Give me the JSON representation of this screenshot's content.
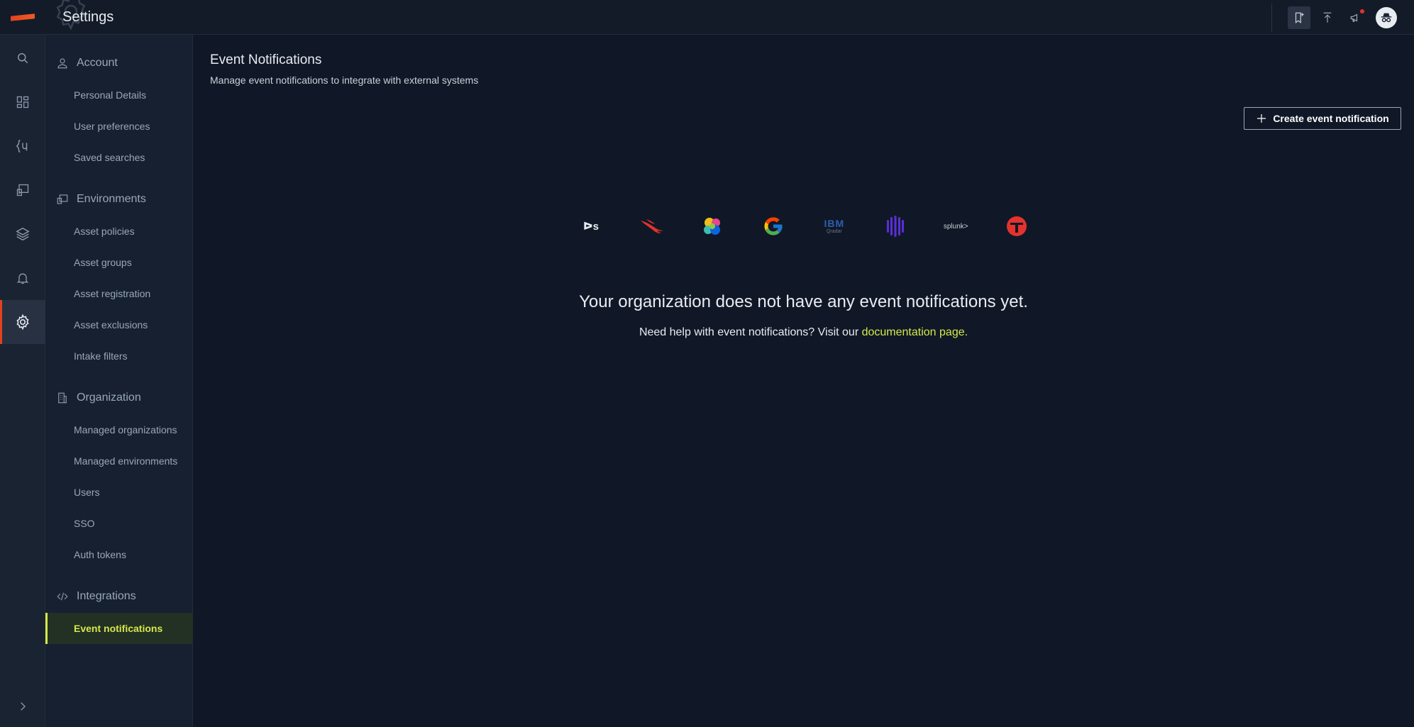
{
  "app": {
    "title": "Settings"
  },
  "colors": {
    "accent": "#e3421f",
    "highlight": "#d4e84a",
    "background": "#101827"
  },
  "topbar": {
    "icons": [
      "bookmark-icon",
      "upload-icon",
      "megaphone-icon",
      "incognito-avatar-icon"
    ]
  },
  "rail": {
    "items": [
      "search-icon",
      "dashboard-icon",
      "query-icon",
      "assets-icon",
      "layers-icon",
      "bell-icon",
      "gear-icon"
    ],
    "active": "gear-icon",
    "expand_icon": "chevron-right-icon"
  },
  "sidebar": {
    "account": {
      "label": "Account",
      "items": [
        "Personal Details",
        "User preferences",
        "Saved searches"
      ]
    },
    "environments": {
      "label": "Environments",
      "items": [
        "Asset policies",
        "Asset groups",
        "Asset registration",
        "Asset exclusions",
        "Intake filters"
      ]
    },
    "organization": {
      "label": "Organization",
      "items": [
        "Managed organizations",
        "Managed environments",
        "Users",
        "SSO",
        "Auth tokens"
      ]
    },
    "integrations": {
      "label": "Integrations",
      "items": [
        "Event notifications"
      ]
    },
    "active_item": "Event notifications"
  },
  "main": {
    "title": "Event Notifications",
    "subtitle": "Manage event notifications to integrate with external systems",
    "create_button": "Create event notification",
    "logos": {
      "ds": "ᐅs",
      "ibm": "IBM",
      "ibm_sub": "Qradar",
      "splunk": "splunk>"
    },
    "empty_title": "Your organization does not have any event notifications yet.",
    "help_prefix": "Need help with event notifications? Visit our ",
    "help_link": "documentation page."
  }
}
